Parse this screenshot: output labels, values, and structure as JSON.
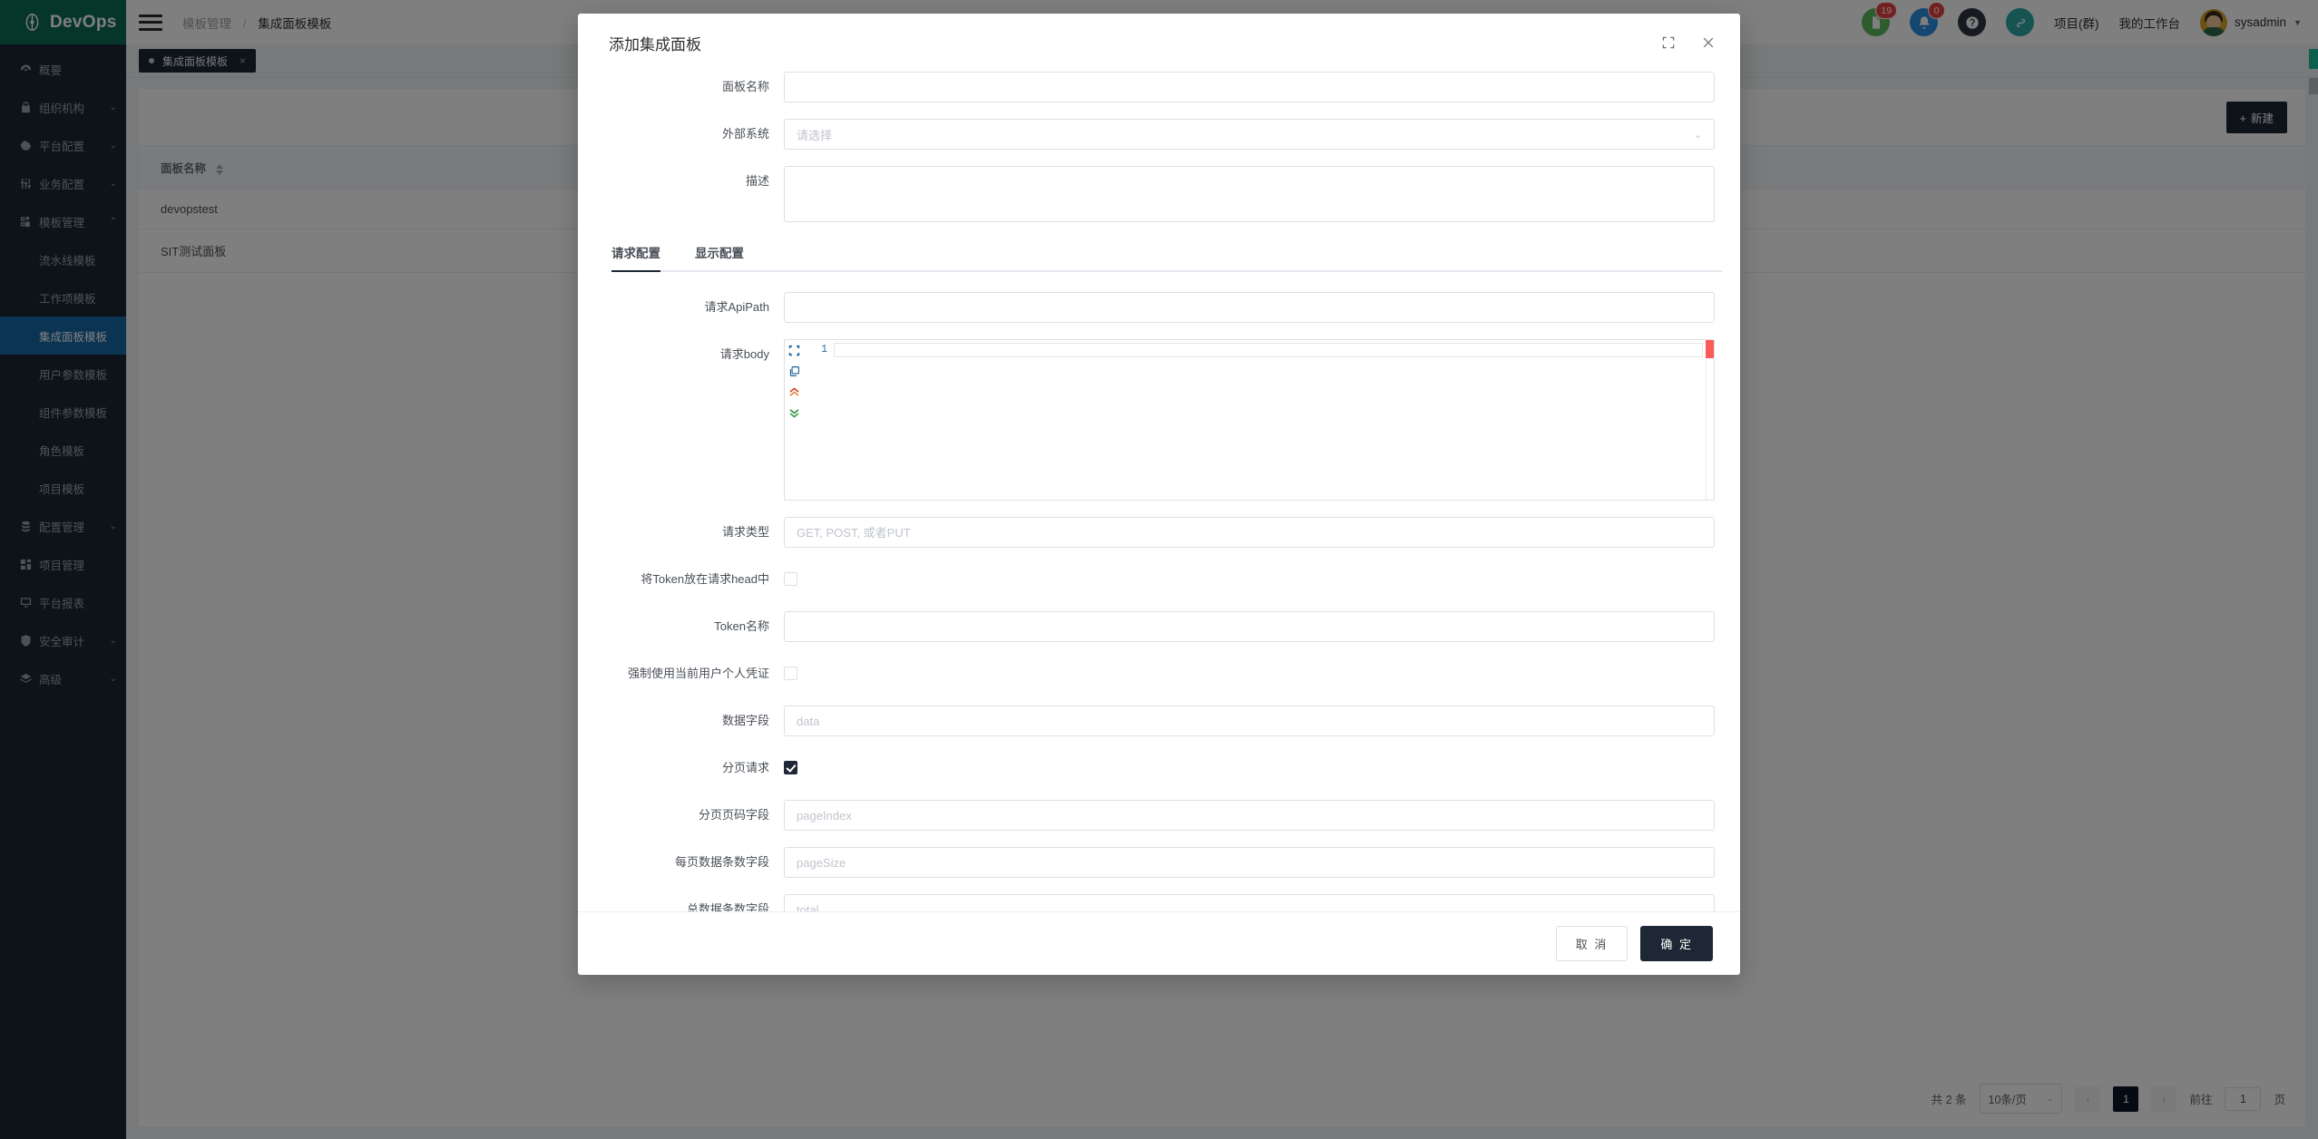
{
  "brand": {
    "name": "DevOps",
    "color": "#0c6b52"
  },
  "sidebar": {
    "items": [
      {
        "label": "概要",
        "icon": "dashboard-icon",
        "expandable": false
      },
      {
        "label": "组织机构",
        "icon": "lock-icon",
        "expandable": true
      },
      {
        "label": "平台配置",
        "icon": "gear-icon",
        "expandable": true
      },
      {
        "label": "业务配置",
        "icon": "sliders-icon",
        "expandable": true
      },
      {
        "label": "模板管理",
        "icon": "users-icon",
        "expandable": true,
        "expanded": true
      }
    ],
    "sub_items": [
      {
        "label": "流水线模板",
        "active": false
      },
      {
        "label": "工作项模板",
        "active": false
      },
      {
        "label": "集成面板模板",
        "active": true
      },
      {
        "label": "用户参数模板",
        "active": false
      },
      {
        "label": "组件参数模板",
        "active": false
      },
      {
        "label": "角色模板",
        "active": false
      },
      {
        "label": "项目模板",
        "active": false
      }
    ],
    "items_after": [
      {
        "label": "配置管理",
        "icon": "database-icon",
        "expandable": true
      },
      {
        "label": "项目管理",
        "icon": "grid-icon",
        "expandable": false
      },
      {
        "label": "平台报表",
        "icon": "monitor-icon",
        "expandable": false
      },
      {
        "label": "安全审计",
        "icon": "shield-icon",
        "expandable": true
      },
      {
        "label": "高级",
        "icon": "stack-icon",
        "expandable": true
      }
    ]
  },
  "header": {
    "breadcrumb_parent": "模板管理",
    "breadcrumb_sep": "/",
    "breadcrumb_current": "集成面板模板",
    "doc_badge": "19",
    "bell_badge": "0",
    "link_project": "项目(群)",
    "link_workbench": "我的工作台",
    "user_name": "sysadmin"
  },
  "page_tab": {
    "label": "集成面板模板",
    "close": "×"
  },
  "main": {
    "new_button": "新建",
    "new_button_plus": "+",
    "table": {
      "columns": [
        "面板名称"
      ],
      "rows": [
        [
          "devopstest"
        ],
        [
          "SIT测试面板"
        ]
      ]
    },
    "pagination": {
      "total_text": "共 2 条",
      "page_size": "10条/页",
      "prev": "‹",
      "current_page": "1",
      "next": "›",
      "jump_prefix": "前往",
      "jump_value": "1",
      "jump_suffix": "页"
    }
  },
  "modal": {
    "title": "添加集成面板",
    "maximize_icon": "maximize-icon",
    "close_icon": "close-icon",
    "fields": {
      "panel_name_label": "面板名称",
      "panel_name_value": "",
      "external_system_label": "外部系统",
      "external_system_placeholder": "请选择",
      "description_label": "描述",
      "description_value": ""
    },
    "tabs": [
      {
        "label": "请求配置",
        "active": true
      },
      {
        "label": "显示配置",
        "active": false
      }
    ],
    "request": {
      "api_path_label": "请求ApiPath",
      "api_path_value": "",
      "body_label": "请求body",
      "body_line_number": "1",
      "body_value": "",
      "editor_icons": [
        "fullscreen-icon",
        "copy-icon",
        "collapse-up-icon",
        "expand-down-icon"
      ],
      "method_label": "请求类型",
      "method_placeholder": "GET, POST, 或者PUT",
      "token_in_head_label": "将Token放在请求head中",
      "token_in_head_checked": false,
      "token_name_label": "Token名称",
      "token_name_value": "",
      "force_personal_cred_label": "强制使用当前用户个人凭证",
      "force_personal_cred_checked": false,
      "data_field_label": "数据字段",
      "data_field_placeholder": "data",
      "paging_label": "分页请求",
      "paging_checked": true,
      "page_index_label": "分页页码字段",
      "page_index_placeholder": "pageIndex",
      "page_size_label": "每页数据条数字段",
      "page_size_placeholder": "pageSize",
      "total_label": "总数据条数字段",
      "total_placeholder": "total"
    },
    "footer": {
      "cancel": "取 消",
      "confirm": "确 定"
    }
  },
  "colors": {
    "brand_green": "#0c6b52",
    "sidebar_bg": "#1d2735",
    "accent_blue": "#1666a5",
    "primary_dark": "#1d2735",
    "badge_red": "#e64340",
    "error_red": "#fb5a5a"
  }
}
